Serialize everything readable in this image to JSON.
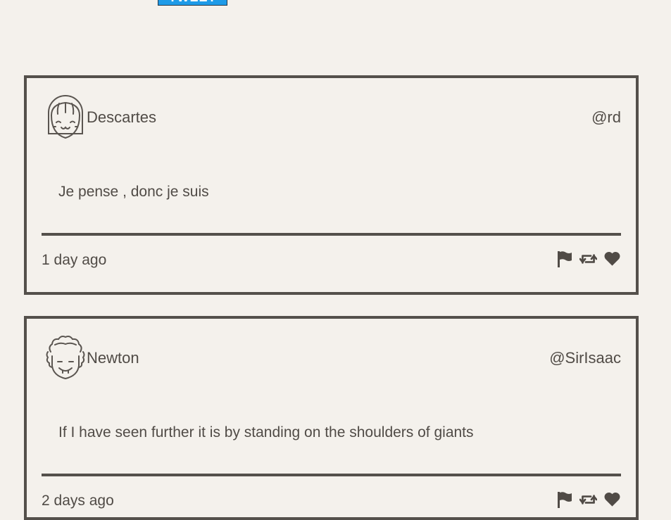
{
  "top_button": {
    "label": "TWEET"
  },
  "tweets": [
    {
      "name": "Descartes",
      "handle": "@rd",
      "message": "Je pense , donc je suis",
      "time": "1 day ago",
      "avatar_icon": "girl-face-icon"
    },
    {
      "name": "Newton",
      "handle": "@SirIsaac",
      "message": "If I have seen further it is by standing on the shoulders of giants",
      "time": "2 days ago",
      "avatar_icon": "curly-hair-face-icon"
    }
  ],
  "actions": [
    "flag-icon",
    "retweet-icon",
    "heart-icon"
  ],
  "colors": {
    "background": "#f4f1ec",
    "border": "#54504b",
    "text": "#504b46",
    "button": "#1e9be8"
  }
}
